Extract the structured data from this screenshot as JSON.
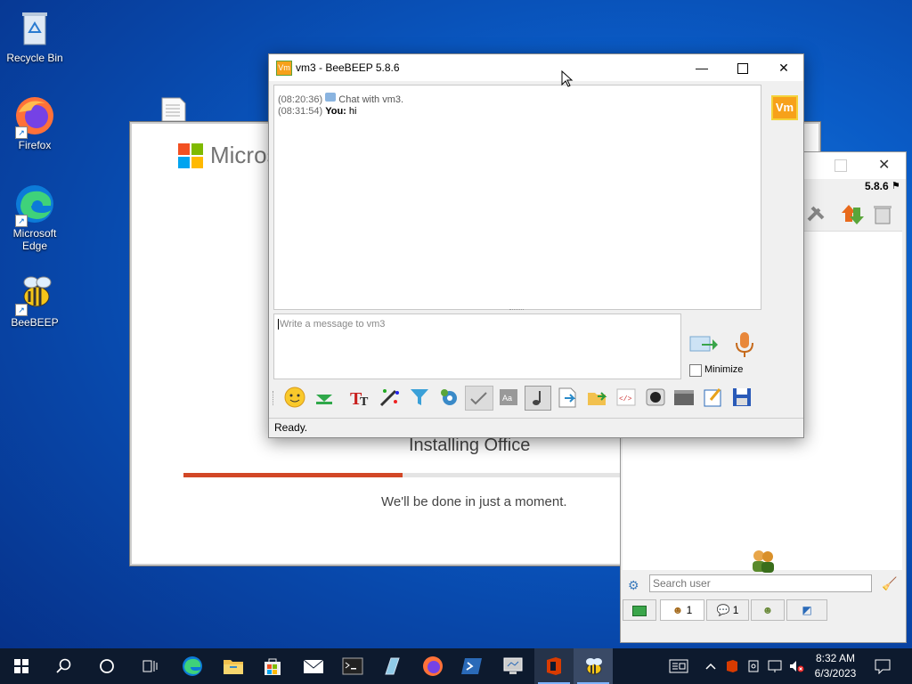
{
  "desktop": {
    "icons": [
      {
        "label": "Recycle Bin"
      },
      {
        "label": "Firefox"
      },
      {
        "label": "Microsoft Edge"
      },
      {
        "label": "BeeBEEP"
      }
    ]
  },
  "office": {
    "logo_text": "Micros",
    "title": "Installing Office",
    "subtitle": "We'll be done in just a moment.",
    "progress": 0.41,
    "progress_color": "#d24726"
  },
  "beebeep_main": {
    "version": "5.8.6",
    "search_placeholder": "Search user",
    "tabs": [
      {
        "icon": "users-icon",
        "count": "1"
      },
      {
        "icon": "chat-icon",
        "count": "1"
      },
      {
        "icon": "groups-icon",
        "count": ""
      },
      {
        "icon": "share-icon",
        "count": ""
      }
    ]
  },
  "chat": {
    "window_title": "vm3 - BeeBEEP 5.8.6",
    "app_icon_text": "Vm",
    "avatar_text": "Vm",
    "log": [
      {
        "time": "(08:20:36)",
        "sender": "",
        "text": "Chat with vm3."
      },
      {
        "time": "(08:31:54)",
        "sender": "You:",
        "text": "hi"
      }
    ],
    "input_placeholder": "Write a message to vm3",
    "minimize_label": "Minimize",
    "status": "Ready.",
    "toolbar": [
      "emoji-icon",
      "download-icon",
      "font-icon",
      "color-picker-icon",
      "filter-icon",
      "settings-icon",
      "spell-check-icon",
      "font-size-icon",
      "music-note-icon",
      "save-icon",
      "folder-icon",
      "html-icon",
      "camera-icon",
      "screenshot-icon",
      "edit-icon",
      "floppy-icon"
    ]
  },
  "taskbar": {
    "time": "8:32 AM",
    "date": "6/3/2023"
  }
}
